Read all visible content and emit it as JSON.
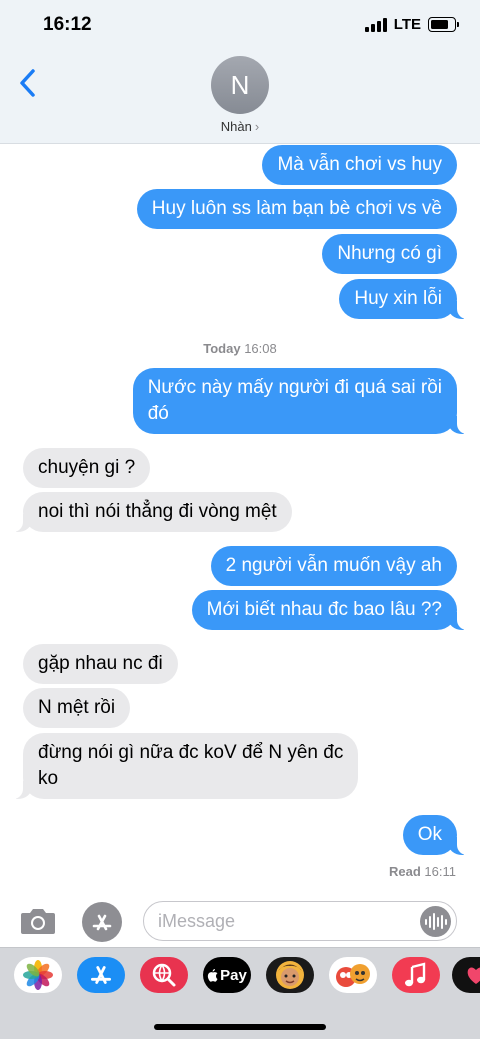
{
  "status_bar": {
    "time": "16:12",
    "network": "LTE",
    "battery_level": 0.75
  },
  "header": {
    "avatar_initial": "N",
    "contact_name": "Nhàn",
    "chevron": "›"
  },
  "messages": [
    {
      "side": "out",
      "text": "Mà vẫn chơi vs huy"
    },
    {
      "side": "out",
      "text": "Huy luôn ss làm bạn bè chơi vs về"
    },
    {
      "side": "out",
      "text": "Nhưng có gì"
    },
    {
      "side": "out",
      "text": "Huy xin lỗi"
    },
    {
      "side": "out",
      "text": "Nước này mấy người đi quá sai rồi\nđó"
    },
    {
      "side": "in",
      "text": "chuyện gi ?"
    },
    {
      "side": "in",
      "text": "noi thì nói thẳng đi vòng mệt"
    },
    {
      "side": "out",
      "text": "2 người vẫn muốn vậy ah"
    },
    {
      "side": "out",
      "text": "Mới biết nhau đc bao lâu ??"
    },
    {
      "side": "in",
      "text": "gặp nhau nc đi"
    },
    {
      "side": "in",
      "text": "N mệt rồi"
    },
    {
      "side": "in",
      "text": "đừng nói gì nữa đc koV để N yên đc\nko"
    },
    {
      "side": "out",
      "text": "Ok"
    }
  ],
  "timestamp": {
    "day": "Today",
    "time": "16:08"
  },
  "read_receipt": {
    "label": "Read",
    "time": "16:11"
  },
  "input": {
    "placeholder": "iMessage",
    "value": ""
  },
  "icons": {
    "back": "chevron-left-icon",
    "camera": "camera-icon",
    "appstore": "appstore-icon",
    "audio": "waveform-icon",
    "apps": [
      "photos-icon",
      "appstore-icon",
      "web-search-icon",
      "apple-pay-icon",
      "memoji-icon",
      "animoji-stickers-icon",
      "music-icon",
      "digital-touch-icon"
    ]
  },
  "apple_pay_label": "Pay",
  "colors": {
    "outgoing": "#3a98f8",
    "incoming": "#e9e9eb",
    "accent": "#1a7cf5"
  }
}
